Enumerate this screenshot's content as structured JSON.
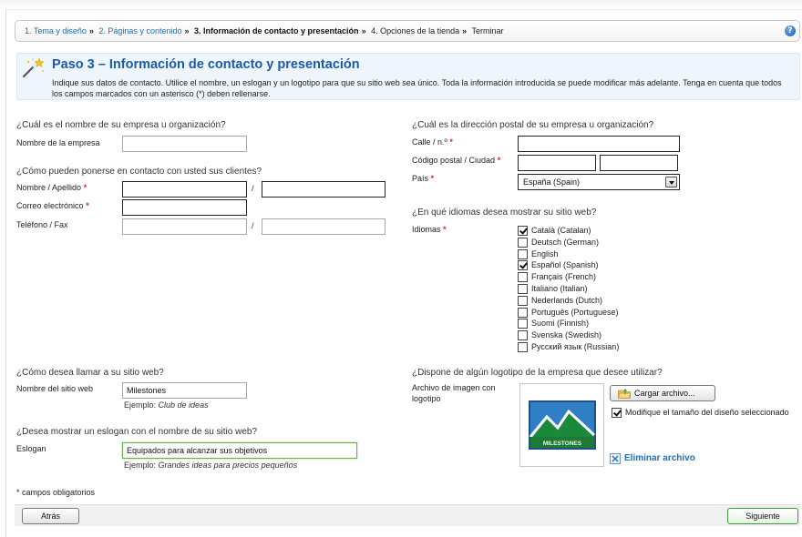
{
  "steps": {
    "step1": "1. Tema y diseño",
    "step2": "2. Páginas y contenido",
    "step3": "3. Información de contacto y presentación",
    "step4": "4. Opciones de la tienda",
    "step5": "Terminar",
    "separator": "»",
    "help_icon": "?"
  },
  "header": {
    "title": "Paso 3 – Información de contacto y presentación",
    "intro": "Indique sus datos de contacto. Utilice el nombre, un eslogan y un logotipo para que su sitio web sea único. Toda la información introducida se puede modificar más adelante. Tenga en cuenta que todos los campos marcados con un asterisco (*) deben rellenarse."
  },
  "company": {
    "question": "¿Cuál es el nombre de su empresa u organización?",
    "name_label": "Nombre de la empresa",
    "name_value": ""
  },
  "contact": {
    "question": "¿Cómo pueden ponerse en contacto con usted sus clientes?",
    "name_label": "Nombre / Apellido",
    "email_label": "Correo electrónico",
    "phone_label": "Teléfono / Fax",
    "slash": "/",
    "required_mark": "*"
  },
  "address": {
    "question": "¿Cuál es la dirección postal de su empresa u organización?",
    "street_label": "Calle / n.º",
    "zip_label": "Código postal / Ciudad",
    "country_label": "País",
    "country_value": "España (Spain)"
  },
  "languages": {
    "question": "¿En qué idiomas desea mostrar su sitio web?",
    "label": "Idiomas",
    "items": [
      {
        "name": "Català (Catalan)",
        "checked": true
      },
      {
        "name": "Deutsch (German)",
        "checked": false
      },
      {
        "name": "English",
        "checked": false
      },
      {
        "name": "Español (Spanish)",
        "checked": true
      },
      {
        "name": "Français (French)",
        "checked": false
      },
      {
        "name": "Italiano (Italian)",
        "checked": false
      },
      {
        "name": "Nederlands (Dutch)",
        "checked": false
      },
      {
        "name": "Português (Portuguese)",
        "checked": false
      },
      {
        "name": "Suomi (Finnish)",
        "checked": false
      },
      {
        "name": "Svenska (Swedish)",
        "checked": false
      },
      {
        "name": "Русский язык (Russian)",
        "checked": false
      }
    ]
  },
  "site_name": {
    "question": "¿Cómo desea llamar a su sitio web?",
    "label": "Nombre del sitio web",
    "value": "Milestones",
    "example_prefix": "Ejemplo:",
    "example": "Club de ideas"
  },
  "slogan": {
    "question": "¿Desea mostrar un eslogan con el nombre de su sitio web?",
    "label": "Eslogan",
    "value": "Equipados para alcanzar sus objetivos",
    "example_prefix": "Ejemplo:",
    "example": "Grandes ideas para precios pequeños"
  },
  "logo": {
    "question": "¿Dispone de algún logotipo de la empresa que desee utilizar?",
    "label": "Archivo de imagen con logotipo",
    "upload_button": "Cargar archivo...",
    "resize_label": "Modifique el tamaño del diseño seleccionado",
    "resize_checked": true,
    "remove_label": "Eliminar archivo",
    "logo_text": "MILESTONES"
  },
  "footer": {
    "required_note": "* campos obligatorios",
    "back_button": "Atrás",
    "next_button": "Siguiente"
  },
  "colors": {
    "link": "#1b6eb8",
    "title": "#1b5ba8",
    "required": "#e2281f",
    "header_bg": "#eef5fc",
    "logo_green": "#2e8b3e",
    "logo_blue": "#1a6fb5"
  }
}
